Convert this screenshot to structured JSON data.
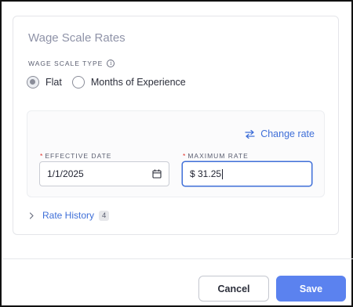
{
  "card": {
    "title": "Wage Scale Rates",
    "type_label": "WAGE SCALE TYPE",
    "type_options": [
      {
        "label": "Flat",
        "selected": true
      },
      {
        "label": "Months of Experience",
        "selected": false
      }
    ]
  },
  "rate_panel": {
    "change_rate_label": "Change rate",
    "effective_date": {
      "required_mark": "*",
      "label": "EFFECTIVE DATE",
      "value": "1/1/2025"
    },
    "maximum_rate": {
      "required_mark": "*",
      "label": "MAXIMUM RATE",
      "value": "$ 31.25"
    }
  },
  "rate_history": {
    "label": "Rate History",
    "count": "4"
  },
  "footer": {
    "cancel_label": "Cancel",
    "save_label": "Save"
  },
  "colors": {
    "accent": "#3f6fd8",
    "save_button": "#5b82ef",
    "required": "#e0322a"
  },
  "icons": {
    "info": "info-icon",
    "change_rate": "swap-arrows-icon",
    "date": "calendar-icon",
    "history": "chevron-right-icon"
  }
}
